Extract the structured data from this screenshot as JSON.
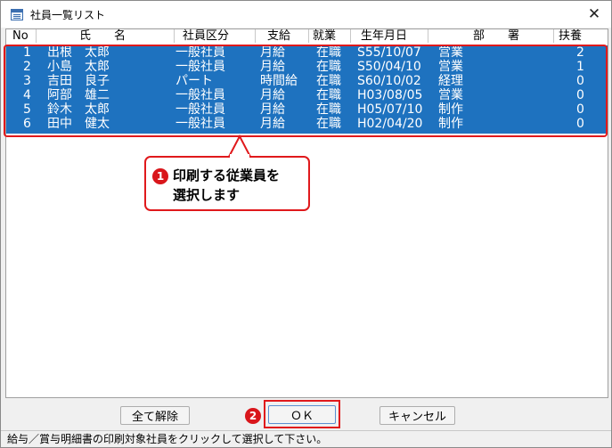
{
  "window": {
    "title": "社員一覧リスト",
    "close_glyph": "✕"
  },
  "columns": [
    "No",
    "氏　　名",
    "社員区分",
    "支給",
    "就業",
    "生年月日",
    "部　　署",
    "扶養"
  ],
  "rows": [
    {
      "no": "1",
      "name": "出根　太郎",
      "kubun": "一般社員",
      "shikyu": "月給",
      "shugyo": "在職",
      "birth": "S55/10/07",
      "busho": "営業",
      "fuyo": "2"
    },
    {
      "no": "2",
      "name": "小島　太郎",
      "kubun": "一般社員",
      "shikyu": "月給",
      "shugyo": "在職",
      "birth": "S50/04/10",
      "busho": "営業",
      "fuyo": "1"
    },
    {
      "no": "3",
      "name": "吉田　良子",
      "kubun": "パート",
      "shikyu": "時間給",
      "shugyo": "在職",
      "birth": "S60/10/02",
      "busho": "経理",
      "fuyo": "0"
    },
    {
      "no": "4",
      "name": "阿部　雄二",
      "kubun": "一般社員",
      "shikyu": "月給",
      "shugyo": "在職",
      "birth": "H03/08/05",
      "busho": "営業",
      "fuyo": "0"
    },
    {
      "no": "5",
      "name": "鈴木　太郎",
      "kubun": "一般社員",
      "shikyu": "月給",
      "shugyo": "在職",
      "birth": "H05/07/10",
      "busho": "制作",
      "fuyo": "0"
    },
    {
      "no": "6",
      "name": "田中　健太",
      "kubun": "一般社員",
      "shikyu": "月給",
      "shugyo": "在職",
      "birth": "H02/04/20",
      "busho": "制作",
      "fuyo": "0"
    }
  ],
  "callout": {
    "badge1": "1",
    "text": "印刷する従業員を\n選択します",
    "badge2": "2"
  },
  "buttons": {
    "clear_all": "全て解除",
    "ok": "ＯＫ",
    "cancel": "キャンセル"
  },
  "status": "給与／賞与明細書の印刷対象社員をクリックして選択して下さい。",
  "colors": {
    "selection": "#1e72bf",
    "highlight": "#e0191c"
  }
}
